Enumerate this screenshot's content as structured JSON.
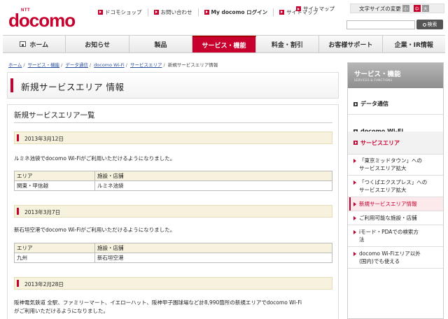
{
  "header": {
    "logo_ntt": "NTT",
    "logo_word": "docomo",
    "links": [
      {
        "label": "ドコモショップ",
        "bold": false
      },
      {
        "label": "お問い合わせ",
        "bold": false
      },
      {
        "label": "My docomo ログイン",
        "bold": true
      },
      {
        "label": "サイトマップ",
        "bold": false
      }
    ],
    "sitemap_top": "サイトマップ",
    "fontsize_label": "文字サイズの変更",
    "fontsize_small": "小",
    "fontsize_medium": "中",
    "fontsize_large": "大",
    "search_value": "",
    "search_button": "検索"
  },
  "nav": {
    "items": [
      {
        "label": "ホーム",
        "active": false
      },
      {
        "label": "お知らせ",
        "active": false
      },
      {
        "label": "製品",
        "active": false
      },
      {
        "label": "サービス・機能",
        "active": true
      },
      {
        "label": "料金・割引",
        "active": false
      },
      {
        "label": "お客様サポート",
        "active": false
      },
      {
        "label": "企業・IR情報",
        "active": false
      }
    ]
  },
  "breadcrumb": {
    "items": [
      "ホーム",
      "サービス・機能",
      "データ通信",
      "docomo Wi-Fi",
      "サービスエリア"
    ],
    "current": "新規サービスエリア情報"
  },
  "page": {
    "title": "新規サービスエリア 情報",
    "section_title": "新規サービスエリア一覧",
    "col_area": "エリア",
    "col_facility": "施設・店舗",
    "entries": [
      {
        "date": "2013年3月12日",
        "text": "ルミネ池袋でdocomo Wi-Fiがご利用いただけるようになりました。",
        "area": "関東・甲信越",
        "facility": "ルミネ池袋"
      },
      {
        "date": "2013年3月7日",
        "text": "新石垣空港でdocomo Wi-Fiがご利用いただけるようになりました。",
        "area": "九州",
        "facility": "新石垣空港"
      },
      {
        "date": "2013年2月28日",
        "text_line1": "阪神電気鉄道 全駅、ファミリーマート、イエローハット、阪神甲子園球場など計8,990箇所の新規エリアでdocomo Wi-Fi",
        "text_line2": "がご利用いただけるようになりました。"
      }
    ]
  },
  "side": {
    "title": "サービス・機能",
    "subtitle": "SERVICES & FUNCTIONS",
    "items": [
      {
        "label": "データ通信",
        "active": false
      },
      {
        "label": "docomo Wi-Fi",
        "active": false
      },
      {
        "label": "サービスエリア",
        "active": true
      }
    ],
    "subitems": [
      {
        "line1": "「東京ミッドタウン」への",
        "line2": "サービスエリア拡大",
        "current": false
      },
      {
        "line1": "「つくばエクスプレス」への",
        "line2": "サービスエリア拡大",
        "current": false
      },
      {
        "line1": "新規サービスエリア情報",
        "line2": "",
        "current": true
      },
      {
        "line1": "ご利用可能な施設・店舗",
        "line2": "",
        "current": false
      },
      {
        "line1": "iモード・PDAでの検索方",
        "line2": "法",
        "current": false
      },
      {
        "line1": "docomo Wi-Fiエリア以外",
        "line2": "(国内)でも使える",
        "current": false
      }
    ]
  }
}
